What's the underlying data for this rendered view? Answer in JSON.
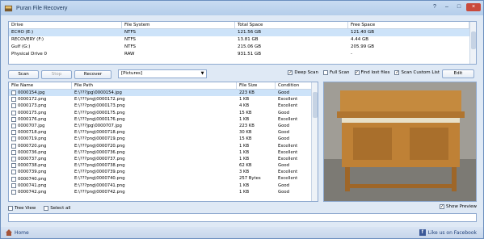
{
  "window": {
    "title": "Puran File Recovery",
    "help_label": "?",
    "minimize_label": "–",
    "maximize_label": "□",
    "close_label": "×"
  },
  "drives": {
    "columns": [
      "Drive",
      "File System",
      "Total Space",
      "Free Space"
    ],
    "rows": [
      {
        "drive": "ECHO (E:)",
        "fs": "NTFS",
        "total": "121.56 GB",
        "free": "121.40 GB",
        "selected": true
      },
      {
        "drive": "RECOVERY (F:)",
        "fs": "NTFS",
        "total": "13.81 GB",
        "free": "4.44 GB"
      },
      {
        "drive": "Gulf (G:)",
        "fs": "NTFS",
        "total": "215.06 GB",
        "free": "205.99 GB"
      },
      {
        "drive": "Physical Drive 0",
        "fs": "RAW",
        "total": "931.51 GB",
        "free": "-"
      }
    ]
  },
  "toolbar": {
    "scan_label": "Scan",
    "stop_label": "Stop",
    "recover_label": "Recover",
    "filter_value": "[Pictures]",
    "deep_scan": "Deep Scan",
    "full_scan": "Full Scan",
    "find_lost": "Find lost files",
    "scan_custom": "Scan Custom List",
    "edit_label": "Edit",
    "deep_scan_checked": true,
    "full_scan_checked": false,
    "find_lost_checked": true,
    "scan_custom_checked": true
  },
  "files": {
    "columns": [
      "File Name",
      "File Path",
      "File Size",
      "Condition"
    ],
    "rows": [
      {
        "name": "0000154.jpg",
        "path": "E:\\???jpg\\0000154.jpg",
        "size": "223 KB",
        "cond": "Good",
        "selected": true
      },
      {
        "name": "0000172.png",
        "path": "E:\\???png\\0000172.png",
        "size": "1 KB",
        "cond": "Excellent"
      },
      {
        "name": "0000173.png",
        "path": "E:\\???png\\0000173.png",
        "size": "4 KB",
        "cond": "Excellent"
      },
      {
        "name": "0000175.png",
        "path": "E:\\???png\\0000175.png",
        "size": "15 KB",
        "cond": "Good"
      },
      {
        "name": "0000176.png",
        "path": "E:\\???png\\0000176.png",
        "size": "1 KB",
        "cond": "Excellent"
      },
      {
        "name": "0000707.jpg",
        "path": "E:\\???jpg\\0000707.jpg",
        "size": "223 KB",
        "cond": "Good"
      },
      {
        "name": "0000718.png",
        "path": "E:\\???png\\0000718.png",
        "size": "30 KB",
        "cond": "Good"
      },
      {
        "name": "0000719.png",
        "path": "E:\\???png\\0000719.png",
        "size": "15 KB",
        "cond": "Good"
      },
      {
        "name": "0000720.png",
        "path": "E:\\???png\\0000720.png",
        "size": "1 KB",
        "cond": "Excellent"
      },
      {
        "name": "0000736.png",
        "path": "E:\\???png\\0000736.png",
        "size": "1 KB",
        "cond": "Excellent"
      },
      {
        "name": "0000737.png",
        "path": "E:\\???png\\0000737.png",
        "size": "1 KB",
        "cond": "Excellent"
      },
      {
        "name": "0000738.png",
        "path": "E:\\???png\\0000738.png",
        "size": "62 KB",
        "cond": "Good"
      },
      {
        "name": "0000739.png",
        "path": "E:\\???png\\0000739.png",
        "size": "3 KB",
        "cond": "Excellent"
      },
      {
        "name": "0000740.png",
        "path": "E:\\???png\\0000740.png",
        "size": "257 Bytes",
        "cond": "Excellent"
      },
      {
        "name": "0000741.png",
        "path": "E:\\???png\\0000741.png",
        "size": "1 KB",
        "cond": "Good"
      },
      {
        "name": "0000742.png",
        "path": "E:\\???png\\0000742.png",
        "size": "1 KB",
        "cond": "Good"
      }
    ]
  },
  "bottom": {
    "tree_view": "Tree View",
    "select_all": "Select all",
    "show_preview": "Show Preview",
    "show_preview_checked": true
  },
  "footer": {
    "home": "Home",
    "facebook": "Like us on Facebook"
  },
  "colors": {
    "selection": "#cde3f9",
    "border": "#8ea9cf",
    "titlebar": "#b4cdea"
  }
}
